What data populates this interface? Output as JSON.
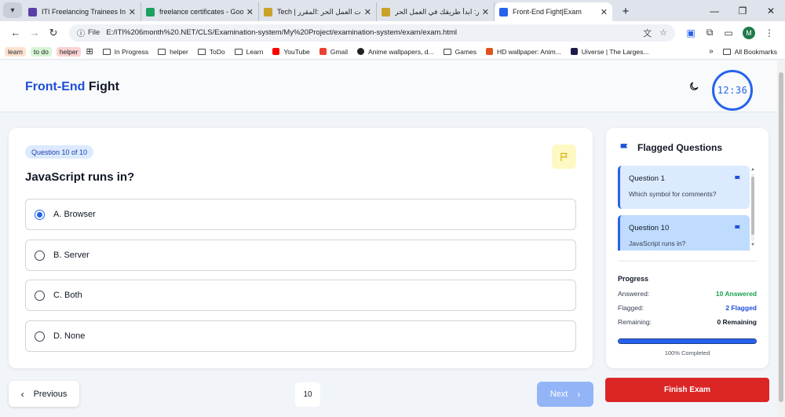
{
  "browser": {
    "tabs": [
      {
        "title": "ITI Freelancing Trainees Info and",
        "favicon_color": "#5b3fa8"
      },
      {
        "title": "freelance certificates - Google D",
        "favicon_color": "#1aa260"
      },
      {
        "title": "Tech | أساسيات العمل الحر :المقرر",
        "favicon_color": "#c9a227"
      },
      {
        "title": "المقرر: ابدأ طريقك في العمل الحر",
        "favicon_color": "#c9a227"
      },
      {
        "title": "Front-End Fight|Exam",
        "favicon_color": "#2563eb"
      }
    ],
    "address": {
      "scheme_label": "File",
      "url": "E:/ITI%206month%20.NET/CLS/Examination-system/My%20Project/examination-system/exam/exam.html"
    },
    "profile_initial": "M",
    "bookmarks": [
      {
        "label": "learn",
        "kind": "pill",
        "bg": "#fde2d2"
      },
      {
        "label": "to do",
        "kind": "pill",
        "bg": "#d6f5d6"
      },
      {
        "label": "helper",
        "kind": "pill",
        "bg": "#fbd3d3"
      },
      {
        "label": "In Progress",
        "kind": "folder"
      },
      {
        "label": "helper",
        "kind": "folder"
      },
      {
        "label": "ToDo",
        "kind": "folder"
      },
      {
        "label": "Learn",
        "kind": "folder"
      },
      {
        "label": "YouTube",
        "kind": "site",
        "color": "#ff0000"
      },
      {
        "label": "Gmail",
        "kind": "site",
        "color": "#ea4335"
      },
      {
        "label": "Anime wallpapers, d...",
        "kind": "site",
        "color": "#222222"
      },
      {
        "label": "Games",
        "kind": "folder"
      },
      {
        "label": "HD wallpaper: Anim...",
        "kind": "site",
        "color": "#e0531f"
      },
      {
        "label": "Uiverse | The Larges...",
        "kind": "site",
        "color": "#1e1b4b"
      }
    ],
    "all_bookmarks_label": "All Bookmarks"
  },
  "header": {
    "brand_part1": "Front-End",
    "brand_part2": "Fight",
    "timer": "12:36"
  },
  "question": {
    "badge": "Question 10 of 10",
    "text": "JavaScript runs in?",
    "options": [
      {
        "label": "A. Browser",
        "selected": true
      },
      {
        "label": "B. Server",
        "selected": false
      },
      {
        "label": "C. Both",
        "selected": false
      },
      {
        "label": "D. None",
        "selected": false
      }
    ]
  },
  "sidebar": {
    "title": "Flagged Questions",
    "flagged": [
      {
        "title": "Question 1",
        "text": "Which symbol for comments?",
        "bg": "#dbeafe"
      },
      {
        "title": "Question 10",
        "text": "JavaScript runs in?",
        "bg": "#bfdbfe"
      }
    ],
    "progress": {
      "title": "Progress",
      "answered_label": "Answered:",
      "answered_value": "10 Answered",
      "flagged_label": "Flagged:",
      "flagged_value": "2 Flagged",
      "remaining_label": "Remaining:",
      "remaining_value": "0 Remaining",
      "percent": 100,
      "completed_label": "100% Completed"
    }
  },
  "footer": {
    "previous_label": "Previous",
    "page_number": "10",
    "next_label": "Next",
    "finish_label": "Finish Exam"
  },
  "colors": {
    "accent": "#2563eb",
    "answered": "#16a34a",
    "flagged": "#1d4ed8",
    "danger": "#dc2626"
  }
}
